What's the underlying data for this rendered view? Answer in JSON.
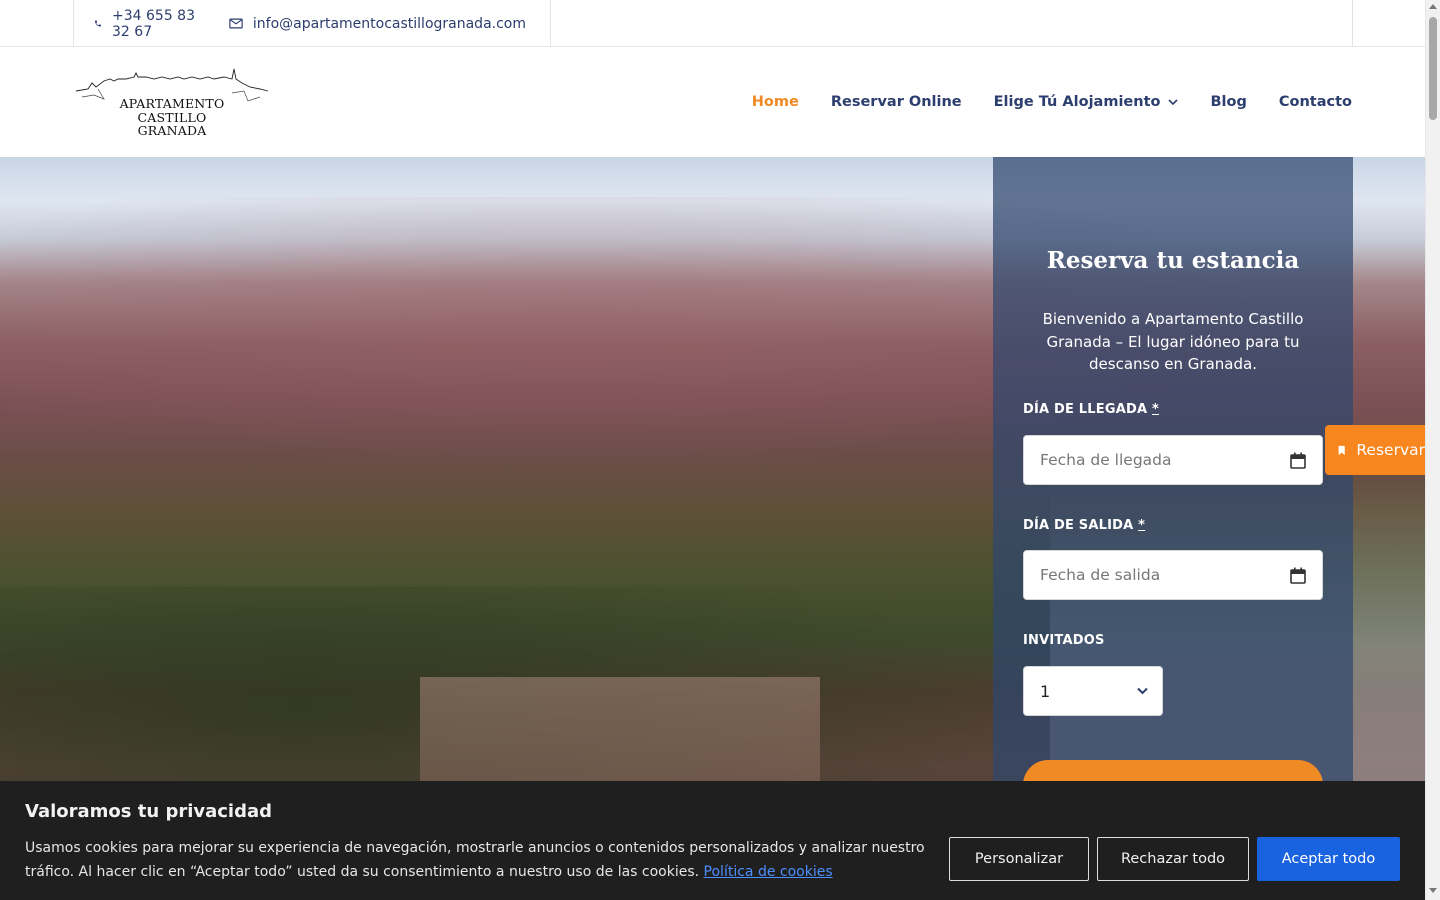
{
  "topbar": {
    "phone": "+34 655 83 32 67",
    "email": "info@apartamentocastillogranada.com"
  },
  "logo": {
    "line1": "APARTAMENTO",
    "line2": "CASTILLO",
    "line3": "GRANADA"
  },
  "nav": {
    "items": [
      {
        "label": "Home",
        "active": true
      },
      {
        "label": "Reservar Online"
      },
      {
        "label": "Elige Tú Alojamiento"
      },
      {
        "label": "Blog"
      },
      {
        "label": "Contacto"
      }
    ]
  },
  "booking": {
    "title": "Reserva tu estancia",
    "intro": "Bienvenido a Apartamento Castillo Granada – El lugar idóneo para tu descanso en Granada.",
    "arrival_label": "DÍA DE LLEGADA",
    "arrival_placeholder": "Fecha de llegada",
    "departure_label": "DÍA DE SALIDA",
    "departure_placeholder": "Fecha de salida",
    "required_mark": "*",
    "guests_label": "INVITADOS",
    "guests_value": "1"
  },
  "float_tab": {
    "label": "Reservar"
  },
  "cookie": {
    "title": "Valoramos tu privacidad",
    "text": "Usamos cookies para mejorar su experiencia de navegación, mostrarle anuncios o contenidos personalizados y analizar nuestro tráfico. Al hacer clic en “Aceptar todo” usted da su consentimiento a nuestro uso de las cookies.",
    "link": "Política de cookies",
    "customize": "Personalizar",
    "reject": "Rechazar todo",
    "accept": "Aceptar todo"
  },
  "colors": {
    "accent": "#f08a24",
    "nav_text": "#2c3e6e",
    "accept_button": "#1a63e0",
    "cookie_bg": "#1f1f1f"
  }
}
